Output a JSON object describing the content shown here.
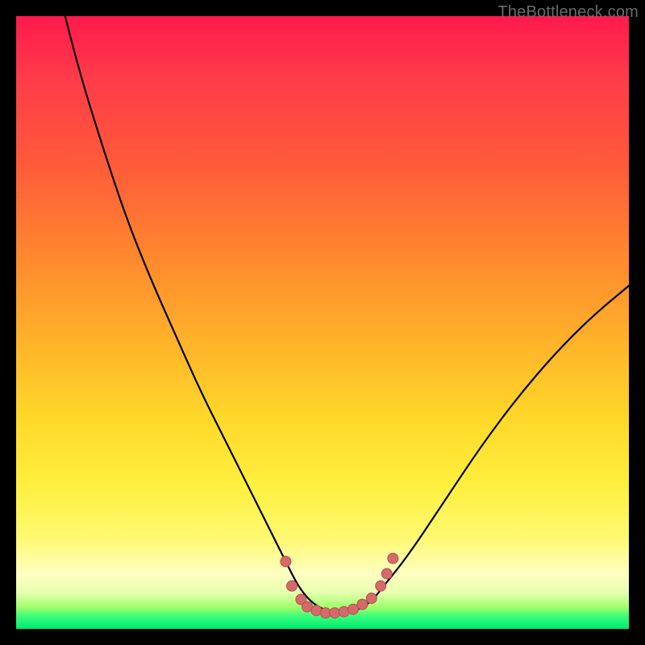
{
  "watermark": "TheBottleneck.com",
  "colors": {
    "frame": "#000000",
    "curve": "#000000",
    "marker_fill": "#d46a6a",
    "marker_stroke": "#b94e4e",
    "gradient_top": "#ff1a4d",
    "gradient_bottom": "#00e874"
  },
  "chart_data": {
    "type": "line",
    "title": "",
    "xlabel": "",
    "ylabel": "",
    "xlim": [
      0,
      100
    ],
    "ylim": [
      0,
      100
    ],
    "grid": false,
    "series": [
      {
        "name": "curve",
        "x": [
          8,
          10,
          14,
          18,
          22,
          26,
          30,
          34,
          38,
          42,
          44,
          46,
          48,
          50,
          52,
          54,
          56,
          58,
          60,
          64,
          70,
          76,
          82,
          88,
          94,
          100
        ],
        "y": [
          100,
          92,
          79,
          67,
          57,
          48,
          39,
          31,
          23,
          15,
          11,
          7,
          4.5,
          3.2,
          2.6,
          2.6,
          3.2,
          4.5,
          7,
          12,
          21,
          30,
          38,
          45,
          51,
          56
        ]
      }
    ],
    "markers": {
      "name": "bottom-cluster",
      "x": [
        44.0,
        45.0,
        46.5,
        47.5,
        49.0,
        50.5,
        52.0,
        53.5,
        55.0,
        56.5,
        58.0,
        59.5,
        60.5,
        61.5
      ],
      "y": [
        11.0,
        7.0,
        4.8,
        3.6,
        3.0,
        2.6,
        2.6,
        2.8,
        3.2,
        4.0,
        5.0,
        7.0,
        9.0,
        11.5
      ]
    },
    "legend": false
  }
}
